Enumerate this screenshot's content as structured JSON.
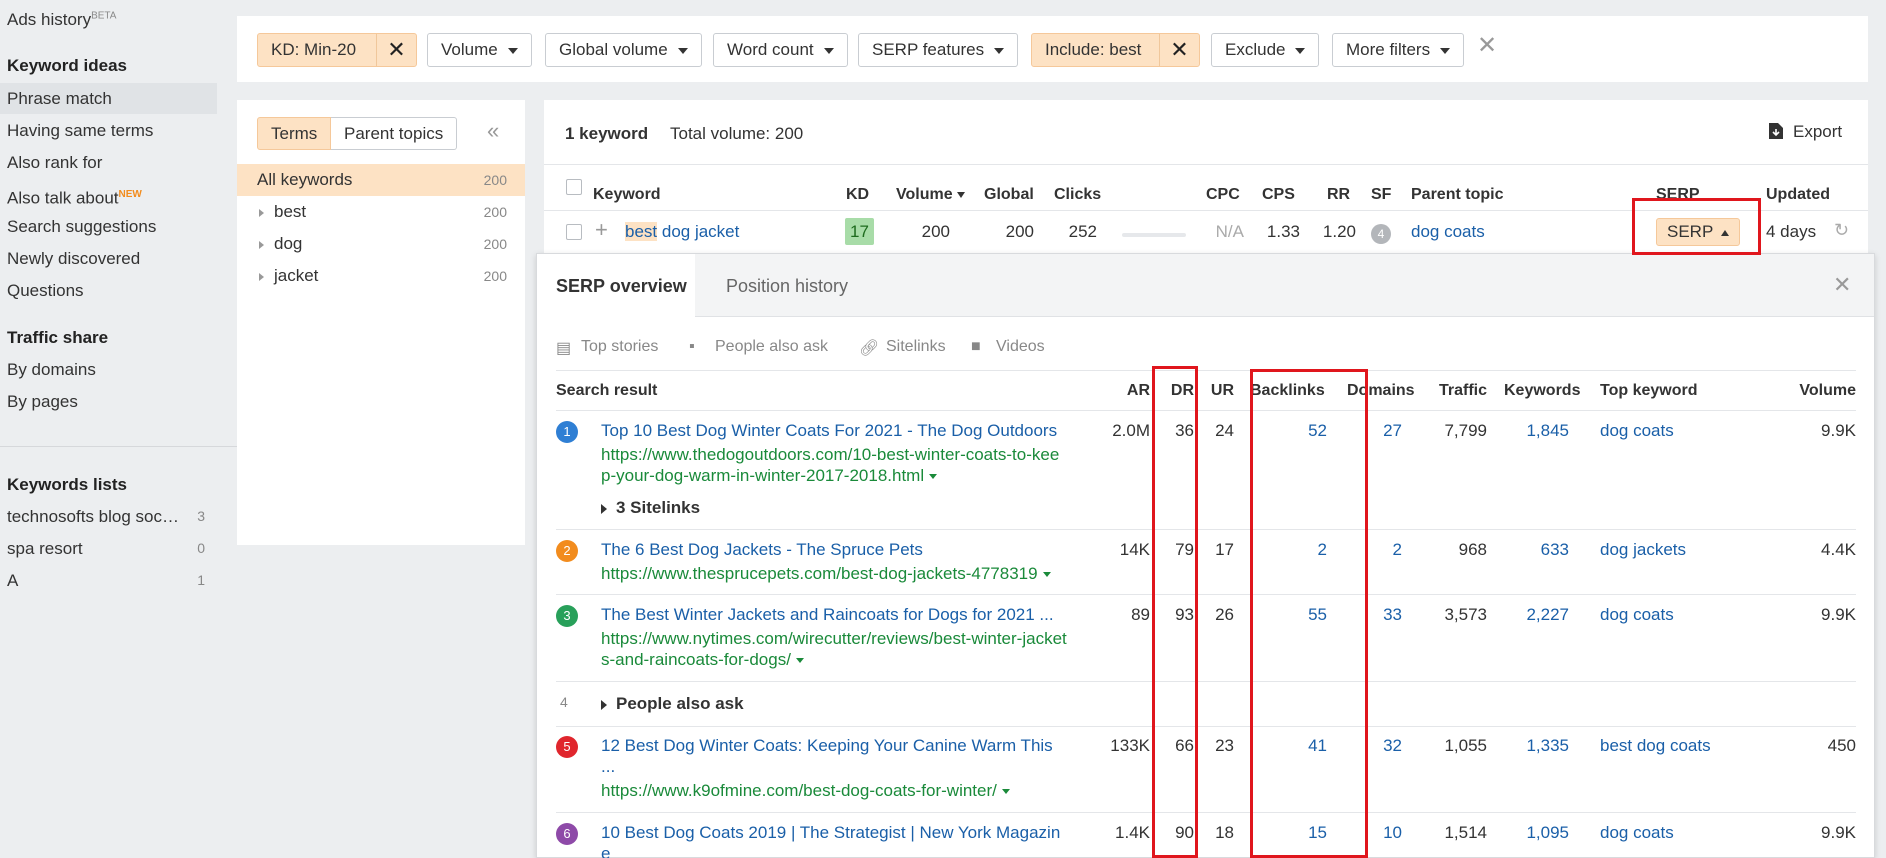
{
  "sidebar": {
    "ads_history": "Ads history",
    "ads_badge": "BETA",
    "keyword_ideas_heading": "Keyword ideas",
    "keyword_ideas": [
      {
        "label": "Phrase match"
      },
      {
        "label": "Having same terms"
      },
      {
        "label": "Also rank for"
      },
      {
        "label": "Also talk about",
        "badge": "NEW"
      },
      {
        "label": "Search suggestions"
      },
      {
        "label": "Newly discovered"
      },
      {
        "label": "Questions"
      }
    ],
    "traffic_share_heading": "Traffic share",
    "traffic_share": [
      {
        "label": "By domains"
      },
      {
        "label": "By pages"
      }
    ],
    "keywords_lists_heading": "Keywords lists",
    "keywords_lists": [
      {
        "label": "technosofts blog soc…",
        "count": "3"
      },
      {
        "label": "spa resort",
        "count": "0"
      },
      {
        "label": "A",
        "count": "1"
      }
    ]
  },
  "filters": {
    "kd": "KD: Min-20",
    "volume": "Volume",
    "global_volume": "Global volume",
    "word_count": "Word count",
    "serp_features": "SERP features",
    "include": "Include: best",
    "exclude": "Exclude",
    "more_filters": "More filters"
  },
  "terms_panel": {
    "tab_terms": "Terms",
    "tab_parent": "Parent topics",
    "items": [
      {
        "label": "All keywords",
        "count": "200"
      },
      {
        "label": "best",
        "count": "200"
      },
      {
        "label": "dog",
        "count": "200"
      },
      {
        "label": "jacket",
        "count": "200"
      }
    ]
  },
  "results": {
    "count": "1 keyword",
    "total_volume": "Total volume: 200",
    "export": "Export",
    "headers": {
      "keyword": "Keyword",
      "kd": "KD",
      "volume": "Volume",
      "global": "Global",
      "clicks": "Clicks",
      "cpc": "CPC",
      "cps": "CPS",
      "rr": "RR",
      "sf": "SF",
      "parent_topic": "Parent topic",
      "serp": "SERP",
      "updated": "Updated"
    },
    "row": {
      "keyword_highlight": "best",
      "keyword_rest": " dog jacket",
      "kd": "17",
      "volume": "200",
      "global": "200",
      "clicks": "252",
      "cpc": "N/A",
      "cps": "1.33",
      "rr": "1.20",
      "sf": "4",
      "parent_topic": "dog coats",
      "serp_button": "SERP",
      "updated": "4 days"
    }
  },
  "serp": {
    "tab_overview": "SERP overview",
    "tab_history": "Position history",
    "features": [
      "Top stories",
      "People also ask",
      "Sitelinks",
      "Videos"
    ],
    "headers": {
      "result": "Search result",
      "ar": "AR",
      "dr": "DR",
      "ur": "UR",
      "backlinks": "Backlinks",
      "domains": "Domains",
      "traffic": "Traffic",
      "keywords": "Keywords",
      "top_keyword": "Top keyword",
      "volume": "Volume"
    },
    "rows": [
      {
        "pos": "1",
        "color": "#2f7fd4",
        "title": "Top 10 Best Dog Winter Coats For 2021 - The Dog Outdoors",
        "url1": "https://www.thedogoutdoors.com/10-best-winter-coats-to-kee",
        "url2": "p-your-dog-warm-in-winter-2017-2018.html",
        "ar": "2.0M",
        "dr": "36",
        "ur": "24",
        "backlinks": "52",
        "domains": "27",
        "traffic": "7,799",
        "keywords": "1,845",
        "top_keyword": "dog coats",
        "volume": "9.9K",
        "sitelinks": "3 Sitelinks"
      },
      {
        "pos": "2",
        "color": "#f28c1e",
        "title": "The 6 Best Dog Jackets - The Spruce Pets",
        "url1": "https://www.thesprucepets.com/best-dog-jackets-4778319",
        "ar": "14K",
        "dr": "79",
        "ur": "17",
        "backlinks": "2",
        "domains": "2",
        "traffic": "968",
        "keywords": "633",
        "top_keyword": "dog jackets",
        "volume": "4.4K"
      },
      {
        "pos": "3",
        "color": "#28a05a",
        "title": "The Best Winter Jackets and Raincoats for Dogs for 2021 ...",
        "url1": "https://www.nytimes.com/wirecutter/reviews/best-winter-jacket",
        "url2": "s-and-raincoats-for-dogs/",
        "ar": "89",
        "dr": "93",
        "ur": "26",
        "backlinks": "55",
        "domains": "33",
        "traffic": "3,573",
        "keywords": "2,227",
        "top_keyword": "dog coats",
        "volume": "9.9K"
      },
      {
        "pos": "4",
        "paa": "People also ask"
      },
      {
        "pos": "5",
        "color": "#e0262d",
        "title": "12 Best Dog Winter Coats: Keeping Your Canine Warm This",
        "title2": "...",
        "url1": "https://www.k9ofmine.com/best-dog-coats-for-winter/",
        "ar": "133K",
        "dr": "66",
        "ur": "23",
        "backlinks": "41",
        "domains": "32",
        "traffic": "1,055",
        "keywords": "1,335",
        "top_keyword": "best dog coats",
        "volume": "450"
      },
      {
        "pos": "6",
        "color": "#8e4aa8",
        "title": "10 Best Dog Coats 2019 | The Strategist | New York Magazin",
        "title2": "e",
        "ar": "1.4K",
        "dr": "90",
        "ur": "18",
        "backlinks": "15",
        "domains": "10",
        "traffic": "1,514",
        "keywords": "1,095",
        "top_keyword": "dog coats",
        "volume": "9.9K"
      }
    ]
  }
}
